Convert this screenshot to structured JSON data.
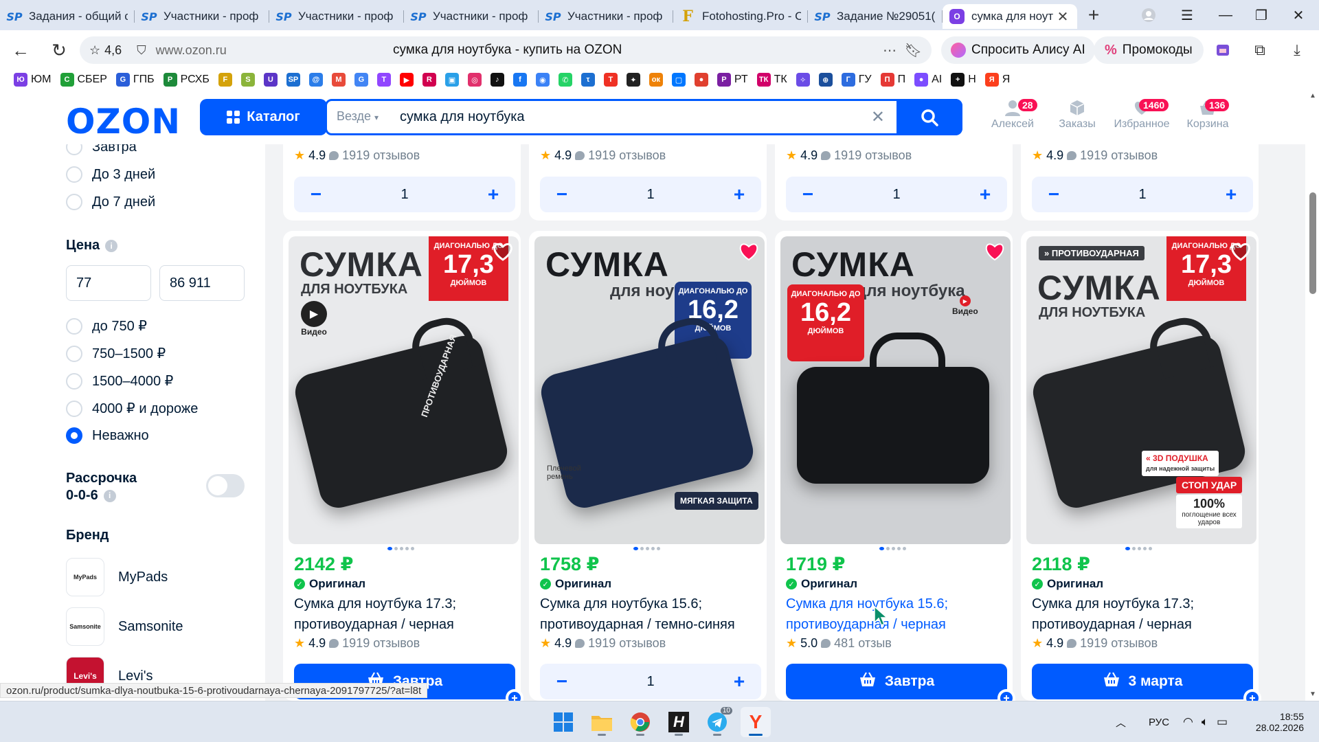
{
  "browser": {
    "tabs": [
      {
        "icon": "sp",
        "title": "Задания - общий с"
      },
      {
        "icon": "sp",
        "title": "Участники - проф"
      },
      {
        "icon": "sp",
        "title": "Участники - проф"
      },
      {
        "icon": "sp",
        "title": "Участники - проф"
      },
      {
        "icon": "sp",
        "title": "Участники - проф"
      },
      {
        "icon": "f",
        "title": "Fotohosting.Pro - С"
      },
      {
        "icon": "sp",
        "title": "Задание №29051("
      },
      {
        "icon": "ozon",
        "title": "сумка для ноут",
        "active": true
      }
    ],
    "rating": "4,6",
    "domain": "www.ozon.ru",
    "page_title": "сумка для ноутбука - купить на OZON",
    "alice_label": "Спросить Алису AI",
    "promo_label": "Промокоды",
    "bookmarks": [
      {
        "label": "ЮМ",
        "color": "#7b3fe4",
        "glyph": "Ю"
      },
      {
        "label": "СБЕР",
        "color": "#21a038",
        "glyph": "С"
      },
      {
        "label": "ГПБ",
        "color": "#2b5fd9",
        "glyph": "G"
      },
      {
        "label": "РСХБ",
        "color": "#1d8a3a",
        "glyph": "Р"
      },
      {
        "label": "",
        "color": "#d4a20a",
        "glyph": "F"
      },
      {
        "label": "",
        "color": "#8bb43a",
        "glyph": "S"
      },
      {
        "label": "",
        "color": "#5b35c7",
        "glyph": "U"
      },
      {
        "label": "",
        "color": "#1c6fd1",
        "glyph": "SP"
      },
      {
        "label": "",
        "color": "#2b7de9",
        "glyph": "@"
      },
      {
        "label": "",
        "color": "#e84b3a",
        "glyph": "M"
      },
      {
        "label": "",
        "color": "#4285f4",
        "glyph": "G"
      },
      {
        "label": "",
        "color": "#9146ff",
        "glyph": "T"
      },
      {
        "label": "",
        "color": "#ff0000",
        "glyph": "▶"
      },
      {
        "label": "",
        "color": "#d1004f",
        "glyph": "R"
      },
      {
        "label": "",
        "color": "#2aa0e8",
        "glyph": "▣"
      },
      {
        "label": "",
        "color": "#e1306c",
        "glyph": "◎"
      },
      {
        "label": "",
        "color": "#111111",
        "glyph": "♪"
      },
      {
        "label": "",
        "color": "#1877f2",
        "glyph": "f"
      },
      {
        "label": "",
        "color": "#3b82f6",
        "glyph": "◉"
      },
      {
        "label": "",
        "color": "#25d366",
        "glyph": "✆"
      },
      {
        "label": "",
        "color": "#1c6fd1",
        "glyph": "τ"
      },
      {
        "label": "",
        "color": "#ef3124",
        "glyph": "T"
      },
      {
        "label": "",
        "color": "#222222",
        "glyph": "✦"
      },
      {
        "label": "",
        "color": "#ee8208",
        "glyph": "ок"
      },
      {
        "label": "",
        "color": "#0077ff",
        "glyph": "▢"
      },
      {
        "label": "",
        "color": "#e0402f",
        "glyph": "●"
      },
      {
        "label": "РТ",
        "color": "#7b1fa2",
        "glyph": "Р"
      },
      {
        "label": "ТК",
        "color": "#d10069",
        "glyph": "ТК"
      },
      {
        "label": "",
        "color": "#6b4ce6",
        "glyph": "✧"
      },
      {
        "label": "",
        "color": "#1b4f9c",
        "glyph": "⊕"
      },
      {
        "label": "ГУ",
        "color": "#2d6cdf",
        "glyph": "Г"
      },
      {
        "label": "П",
        "color": "#e53935",
        "glyph": "П"
      },
      {
        "label": "AI",
        "color": "#7c4dff",
        "glyph": "●"
      },
      {
        "label": "Н",
        "color": "#111111",
        "glyph": "+"
      },
      {
        "label": "Я",
        "color": "#fc3f1d",
        "glyph": "Я"
      }
    ],
    "status_url": "ozon.ru/product/sumka-dlya-noutbuka-15-6-protivoudarnaya-chernaya-2091797725/?at=l8t"
  },
  "header": {
    "logo": "OZON",
    "catalog_label": "Каталог",
    "search_scope": "Везде",
    "search_value": "сумка для ноутбука",
    "items": [
      {
        "name": "profile",
        "label": "Алексей",
        "badge": "28"
      },
      {
        "name": "orders",
        "label": "Заказы",
        "badge": ""
      },
      {
        "name": "favorites",
        "label": "Избранное",
        "badge": "1460"
      },
      {
        "name": "cart",
        "label": "Корзина",
        "badge": "136"
      }
    ]
  },
  "filters": {
    "delivery_options": [
      "Завтра",
      "До 3 дней",
      "До 7 дней"
    ],
    "price_title": "Цена",
    "price_from": "77",
    "price_to": "86 911",
    "price_ranges": [
      {
        "label": "до 750 ₽",
        "selected": false
      },
      {
        "label": "750–1500 ₽",
        "selected": false
      },
      {
        "label": "1500–4000 ₽",
        "selected": false
      },
      {
        "label": "4000 ₽ и дороже",
        "selected": false
      },
      {
        "label": "Неважно",
        "selected": true
      }
    ],
    "installment_line1": "Рассрочка",
    "installment_line2": "0-0-6",
    "installment_on": false,
    "brand_title": "Бренд",
    "brands": [
      {
        "label": "MyPads",
        "logo_text": "MyPads"
      },
      {
        "label": "Samsonite",
        "logo_text": "Samsonite"
      },
      {
        "label": "Levi's",
        "logo_text": "Levi's"
      }
    ]
  },
  "top_row": [
    {
      "rating": "4.9",
      "reviews": "1919 отзывов",
      "qty": "1"
    },
    {
      "rating": "4.9",
      "reviews": "1919 отзывов",
      "qty": "1"
    },
    {
      "rating": "4.9",
      "reviews": "1919 отзывов",
      "qty": "1"
    },
    {
      "rating": "4.9",
      "reviews": "1919 отзывов",
      "qty": "1"
    }
  ],
  "products": [
    {
      "price": "2142 ₽",
      "original_label": "Оригинал",
      "name_line1": "Сумка для ноутбука 17.3;",
      "name_line2": "противоударная / черная",
      "rating": "4.9",
      "reviews": "1919 отзывов",
      "action": "button",
      "button_label": "Завтра",
      "qty": "",
      "favorite": false,
      "img_big": "СУМКА",
      "img_sub": "ДЛЯ НОУТБУКА",
      "badge_top": "ДИАГОНАЛЬЮ ДО",
      "badge_num": "17,3",
      "badge_unit": "ДЮЙМОВ",
      "badge_color": "#e01e28",
      "extra": "Видео",
      "side_text": "ПРОТИВОУДАРНАЯ",
      "bag_color": "#1f2124",
      "bg": "#e9eaec"
    },
    {
      "price": "1758 ₽",
      "original_label": "Оригинал",
      "name_line1": "Сумка для ноутбука 15.6;",
      "name_line2": "противоударная / темно-синяя",
      "rating": "4.9",
      "reviews": "1919 отзывов",
      "action": "stepper",
      "button_label": "",
      "qty": "1",
      "favorite": true,
      "img_big": "СУМКА",
      "img_sub": "для ноутбука",
      "badge_top": "ДИАГОНАЛЬЮ ДО",
      "badge_num": "16,2",
      "badge_unit": "ДЮЙМОВ",
      "badge_color": "#1e3c8a",
      "extra": "МЯГКАЯ ЗАЩИТА",
      "side_text": "Плечевой ремень",
      "bag_color": "#1b2a4a",
      "bg": "#dcdedf"
    },
    {
      "price": "1719 ₽",
      "original_label": "Оригинал",
      "name_line1": "Сумка для ноутбука 15.6;",
      "name_line2": "противоударная / черная",
      "rating": "5.0",
      "reviews": "481 отзыв",
      "action": "button",
      "button_label": "Завтра",
      "qty": "",
      "favorite": true,
      "hover": true,
      "img_big": "СУМКА",
      "img_sub": "для ноутбука",
      "badge_top": "ДИАГОНАЛЬЮ ДО",
      "badge_num": "16,2",
      "badge_unit": "ДЮЙМОВ",
      "badge_color": "#e01e28",
      "extra": "Видео",
      "side_text": "",
      "bag_color": "#15171a",
      "bg": "#cfd1d4"
    },
    {
      "price": "2118 ₽",
      "original_label": "Оригинал",
      "name_line1": "Сумка для ноутбука 17.3;",
      "name_line2": "противоударная / черная",
      "rating": "4.9",
      "reviews": "1919 отзывов",
      "action": "button",
      "button_label": "3 марта",
      "qty": "",
      "favorite": false,
      "img_big": "СУМКА",
      "img_sub": "ДЛЯ НОУТБУКА",
      "badge_top": "ДИАГОНАЛЬЮ ДО",
      "badge_num": "17,3",
      "badge_unit": "ДЮЙМОВ",
      "badge_color": "#e01e28",
      "extra": "3D ПОДУШКА",
      "side_text": "СТОП УДАР",
      "bag_color": "#232528",
      "bg": "#e4e5e7",
      "top_tag": "ПРОТИВОУДАРНАЯ",
      "promo_pct": "100%",
      "promo_sub": "поглощение всех ударов",
      "pillow_sub": "для надежной защиты"
    }
  ],
  "taskbar": {
    "lang": "РУС",
    "time": "18:55",
    "date": "28.02.2026",
    "telegram_badge": "10"
  }
}
